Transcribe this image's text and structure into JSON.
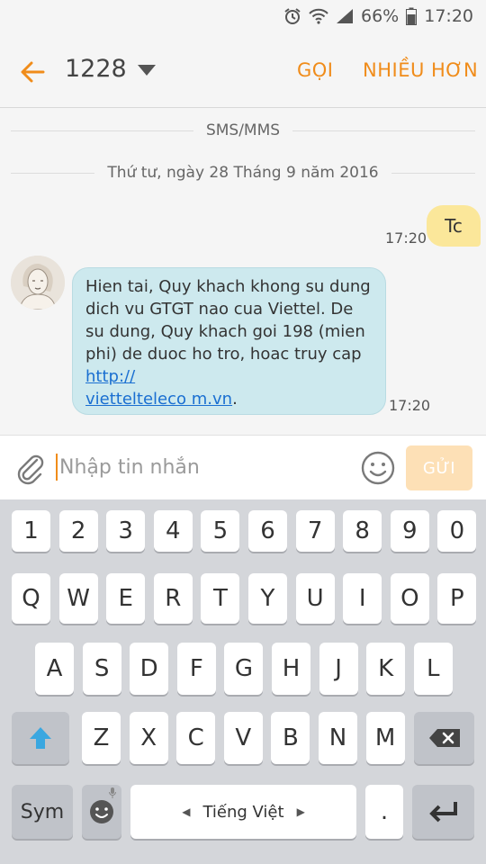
{
  "status_bar": {
    "battery_percent": "66%",
    "time": "17:20",
    "icons": [
      "alarm-icon",
      "wifi-icon",
      "signal-icon",
      "battery-icon"
    ]
  },
  "app_bar": {
    "contact": "1228",
    "call_label": "GỌI",
    "more_label": "NHIỀU HƠN"
  },
  "conversation": {
    "channel_label": "SMS/MMS",
    "date_label": "Thứ tư, ngày 28 Tháng 9 năm 2016",
    "outgoing": {
      "text": "Tc",
      "time": "17:20"
    },
    "incoming": {
      "text_before_link": "Hien tai, Quy khach khong su dung dich vu GTGT nao cua Viettel. De su dung, Quy khach goi 198 (mien phi) de duoc ho tro, hoac truy cap ",
      "link": "http://viettelteleco m.vn",
      "link_line1": "http://",
      "link_line2": "viettelteleco m.vn",
      "after_link": ".",
      "time": "17:20"
    }
  },
  "composer": {
    "placeholder": "Nhập tin nhắn",
    "send_label": "GỬI"
  },
  "keyboard": {
    "row_numbers": [
      "1",
      "2",
      "3",
      "4",
      "5",
      "6",
      "7",
      "8",
      "9",
      "0"
    ],
    "row_top": [
      "Q",
      "W",
      "E",
      "R",
      "T",
      "Y",
      "U",
      "I",
      "O",
      "P"
    ],
    "row_middle": [
      "A",
      "S",
      "D",
      "F",
      "G",
      "H",
      "J",
      "K",
      "L"
    ],
    "row_bottom": [
      "Z",
      "X",
      "C",
      "V",
      "B",
      "N",
      "M"
    ],
    "sym_label": "Sym",
    "space_label": "Tiếng Việt",
    "period_label": "."
  },
  "colors": {
    "accent": "#f08c1a",
    "outgoing_bubble": "#fbe79a",
    "incoming_bubble": "#cde9ee",
    "link": "#1a6fd1",
    "send_disabled": "#fde0b6",
    "shift_active": "#3aa7e0"
  }
}
